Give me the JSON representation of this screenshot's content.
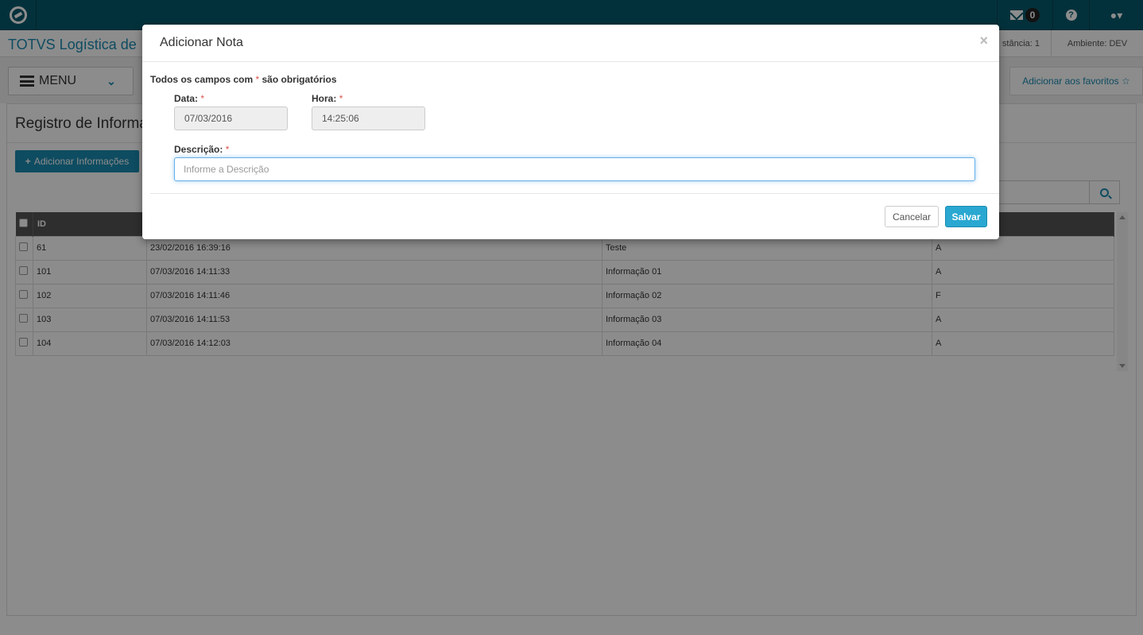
{
  "topbar": {
    "mail_count": "0",
    "help_icon": "question-circle-icon",
    "user_icon": "user-icon"
  },
  "header": {
    "app_title": "TOTVS Logística de",
    "instancia": "stância: 1",
    "ambiente": "Ambiente: DEV"
  },
  "menubar": {
    "menu_label": "MENU",
    "favoritos_label": "Adicionar aos favoritos ☆"
  },
  "page": {
    "title": "Registro de Informa",
    "add_button": "Adicionar Informações"
  },
  "grid": {
    "header_id": "ID",
    "rows": [
      {
        "id": "61",
        "datetime": "23/02/2016 16:39:16",
        "desc": "Teste",
        "status": "A"
      },
      {
        "id": "101",
        "datetime": "07/03/2016 14:11:33",
        "desc": "Informação 01",
        "status": "A"
      },
      {
        "id": "102",
        "datetime": "07/03/2016 14:11:46",
        "desc": "Informação 02",
        "status": "F"
      },
      {
        "id": "103",
        "datetime": "07/03/2016 14:11:53",
        "desc": "Informação 03",
        "status": "A"
      },
      {
        "id": "104",
        "datetime": "07/03/2016 14:12:03",
        "desc": "Informação 04",
        "status": "A"
      }
    ]
  },
  "modal": {
    "title": "Adicionar Nota",
    "close": "×",
    "required_note_prefix": "Todos os campos com ",
    "required_star": "*",
    "required_note_suffix": " são obrigatórios",
    "data_label": "Data:",
    "data_value": "07/03/2016",
    "hora_label": "Hora:",
    "hora_value": "14:25:06",
    "descricao_label": "Descrição:",
    "descricao_placeholder": "Informe a Descrição",
    "cancel_label": "Cancelar",
    "save_label": "Salvar"
  }
}
